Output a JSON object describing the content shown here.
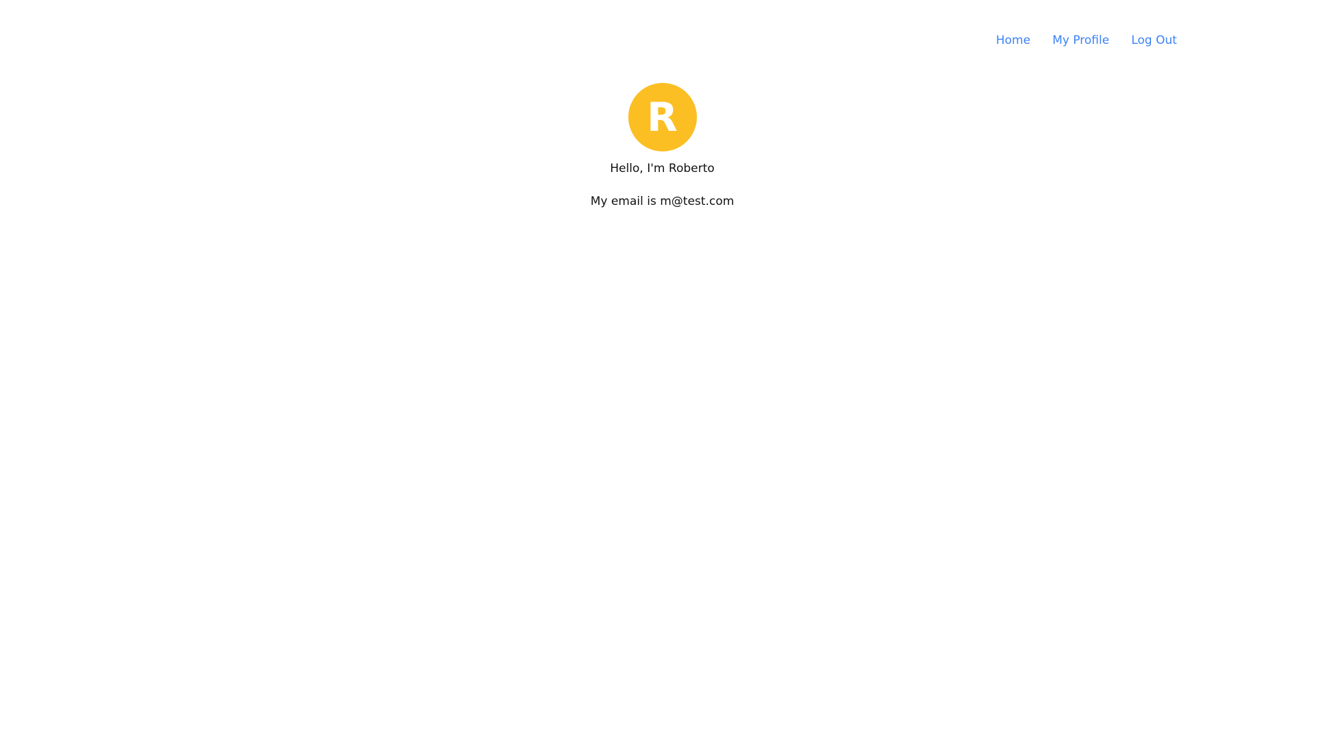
{
  "nav": {
    "items": [
      {
        "label": "Home"
      },
      {
        "label": "My Profile"
      },
      {
        "label": "Log Out"
      }
    ]
  },
  "profile": {
    "avatar_letter": "R",
    "avatar_color": "#fbbf24",
    "greeting": "Hello, I'm Roberto",
    "email_line": "My email is m@test.com"
  },
  "colors": {
    "link": "#3b82f6",
    "text": "#111111",
    "background": "#ffffff"
  }
}
